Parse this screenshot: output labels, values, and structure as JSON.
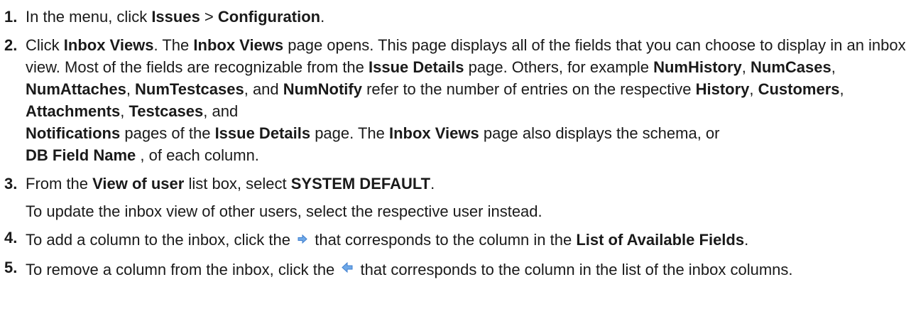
{
  "steps": [
    {
      "number": "1.",
      "parts": [
        "In the menu, click ",
        "Issues",
        " > ",
        "Configuration",
        "."
      ]
    },
    {
      "number": "2.",
      "parts": [
        "Click ",
        "Inbox Views",
        ". The ",
        "Inbox Views",
        " page opens. This page displays all of the fields that you can choose to display in an inbox view. Most of the fields are recognizable from the ",
        "Issue Details",
        " page. Others, for example ",
        "NumHistory",
        ", ",
        "NumCases",
        ", ",
        "NumAttaches",
        ", ",
        "NumTestcases",
        ", and ",
        "NumNotify",
        " refer to the number of entries on the respective ",
        "History",
        ", ",
        "Customers",
        ", ",
        "Attachments",
        ", ",
        "Testcases",
        ", and ",
        "Notifications",
        " pages of the ",
        "Issue Details",
        " page. The ",
        "Inbox Views",
        " page also displays the schema, or ",
        "DB Field Name",
        " , of each column."
      ]
    },
    {
      "number": "3.",
      "parts": [
        "From the ",
        "View of user",
        " list box, select ",
        "SYSTEM DEFAULT",
        "."
      ],
      "note": "To update the inbox view of other users, select the respective user instead."
    },
    {
      "number": "4.",
      "parts": [
        "To add a column to the inbox, click the ",
        " that corresponds to the column in the ",
        "List of Available Fields",
        "."
      ],
      "icon": "arrow-right-icon"
    },
    {
      "number": "5.",
      "parts": [
        "To remove a column from the inbox, click the ",
        " that corresponds to the column in the list of the inbox columns."
      ],
      "icon": "arrow-left-icon"
    }
  ],
  "colors": {
    "text": "#1a1a1a",
    "arrow_fill": "#6fa9e8",
    "arrow_stroke": "#3f7fcf"
  }
}
